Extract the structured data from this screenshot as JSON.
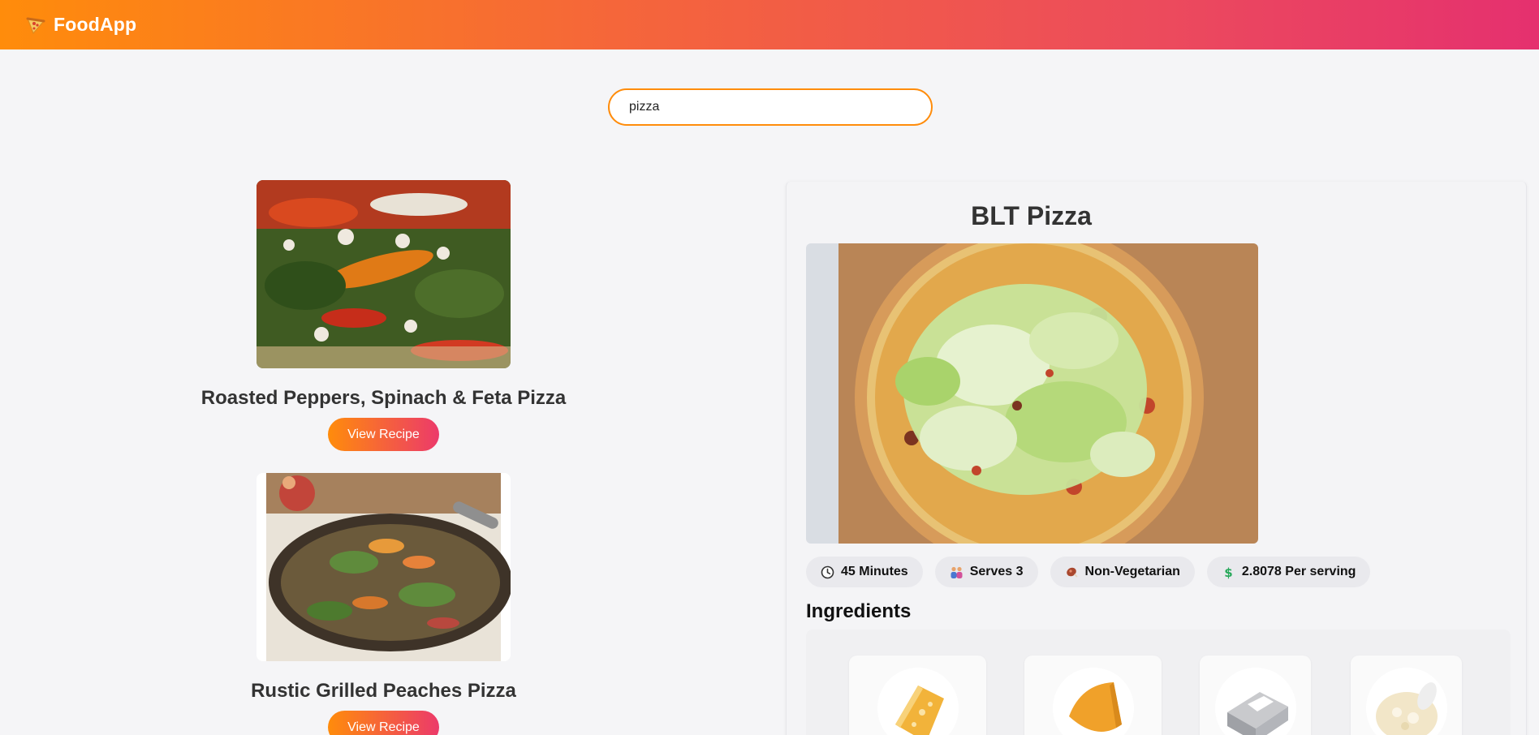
{
  "app": {
    "name": "FoodApp",
    "logo_icon": "pizza-slice-icon"
  },
  "search": {
    "value": "pizza",
    "placeholder": ""
  },
  "results": [
    {
      "title": "Roasted Peppers, Spinach & Feta Pizza",
      "button_label": "View Recipe"
    },
    {
      "title": "Rustic Grilled Peaches Pizza",
      "button_label": "View Recipe"
    }
  ],
  "detail": {
    "title": "BLT Pizza",
    "meta": [
      {
        "icon": "clock-icon",
        "text": "45 Minutes"
      },
      {
        "icon": "people-icon",
        "text": "Serves 3"
      },
      {
        "icon": "meat-icon",
        "text": "Non-Vegetarian"
      },
      {
        "icon": "dollar-icon",
        "text": "2.8078 Per serving"
      }
    ],
    "ingredients_heading": "Ingredients"
  },
  "colors": {
    "accent_start": "#ff8c0b",
    "accent_end": "#e5306f",
    "page_bg": "#f5f5f7"
  }
}
